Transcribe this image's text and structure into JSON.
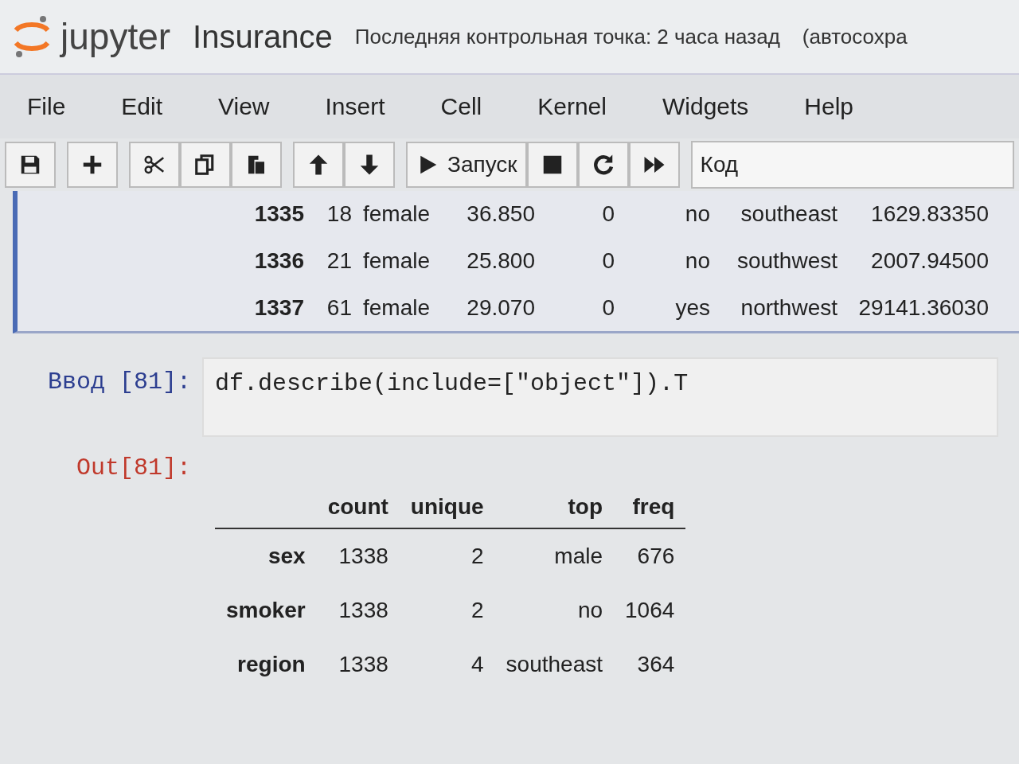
{
  "header": {
    "logo": "jupyter",
    "notebook_name": "Insurance",
    "checkpoint": "Последняя контрольная точка: 2 часа назад",
    "autosave": "(автосохра"
  },
  "menu": [
    "File",
    "Edit",
    "View",
    "Insert",
    "Cell",
    "Kernel",
    "Widgets",
    "Help"
  ],
  "toolbar": {
    "groups": [
      [
        {
          "kind": "save"
        }
      ],
      [
        {
          "kind": "add"
        }
      ],
      [
        {
          "kind": "cut"
        },
        {
          "kind": "copy"
        },
        {
          "kind": "paste"
        }
      ],
      [
        {
          "kind": "up"
        },
        {
          "kind": "down"
        }
      ],
      [
        {
          "kind": "run"
        },
        {
          "kind": "stop"
        },
        {
          "kind": "restart"
        },
        {
          "kind": "fast-forward"
        }
      ]
    ],
    "run_label": "Запуск",
    "cell_type": "Код"
  },
  "previous_output": {
    "rows": [
      [
        "1335",
        "18",
        "female",
        "36.850",
        "0",
        "no",
        "southeast",
        "1629.83350"
      ],
      [
        "1336",
        "21",
        "female",
        "25.800",
        "0",
        "no",
        "southwest",
        "2007.94500"
      ],
      [
        "1337",
        "61",
        "female",
        "29.070",
        "0",
        "yes",
        "northwest",
        "29141.36030"
      ]
    ]
  },
  "input_cell": {
    "prompt": "Ввод [81]:",
    "code": "df.describe(include=[\"object\"]).T"
  },
  "output_cell": {
    "prompt": "Out[81]:",
    "columns": [
      "count",
      "unique",
      "top",
      "freq"
    ],
    "rows": [
      {
        "index": "sex",
        "cells": [
          "1338",
          "2",
          "male",
          "676"
        ]
      },
      {
        "index": "smoker",
        "cells": [
          "1338",
          "2",
          "no",
          "1064"
        ]
      },
      {
        "index": "region",
        "cells": [
          "1338",
          "4",
          "southeast",
          "364"
        ]
      }
    ]
  }
}
